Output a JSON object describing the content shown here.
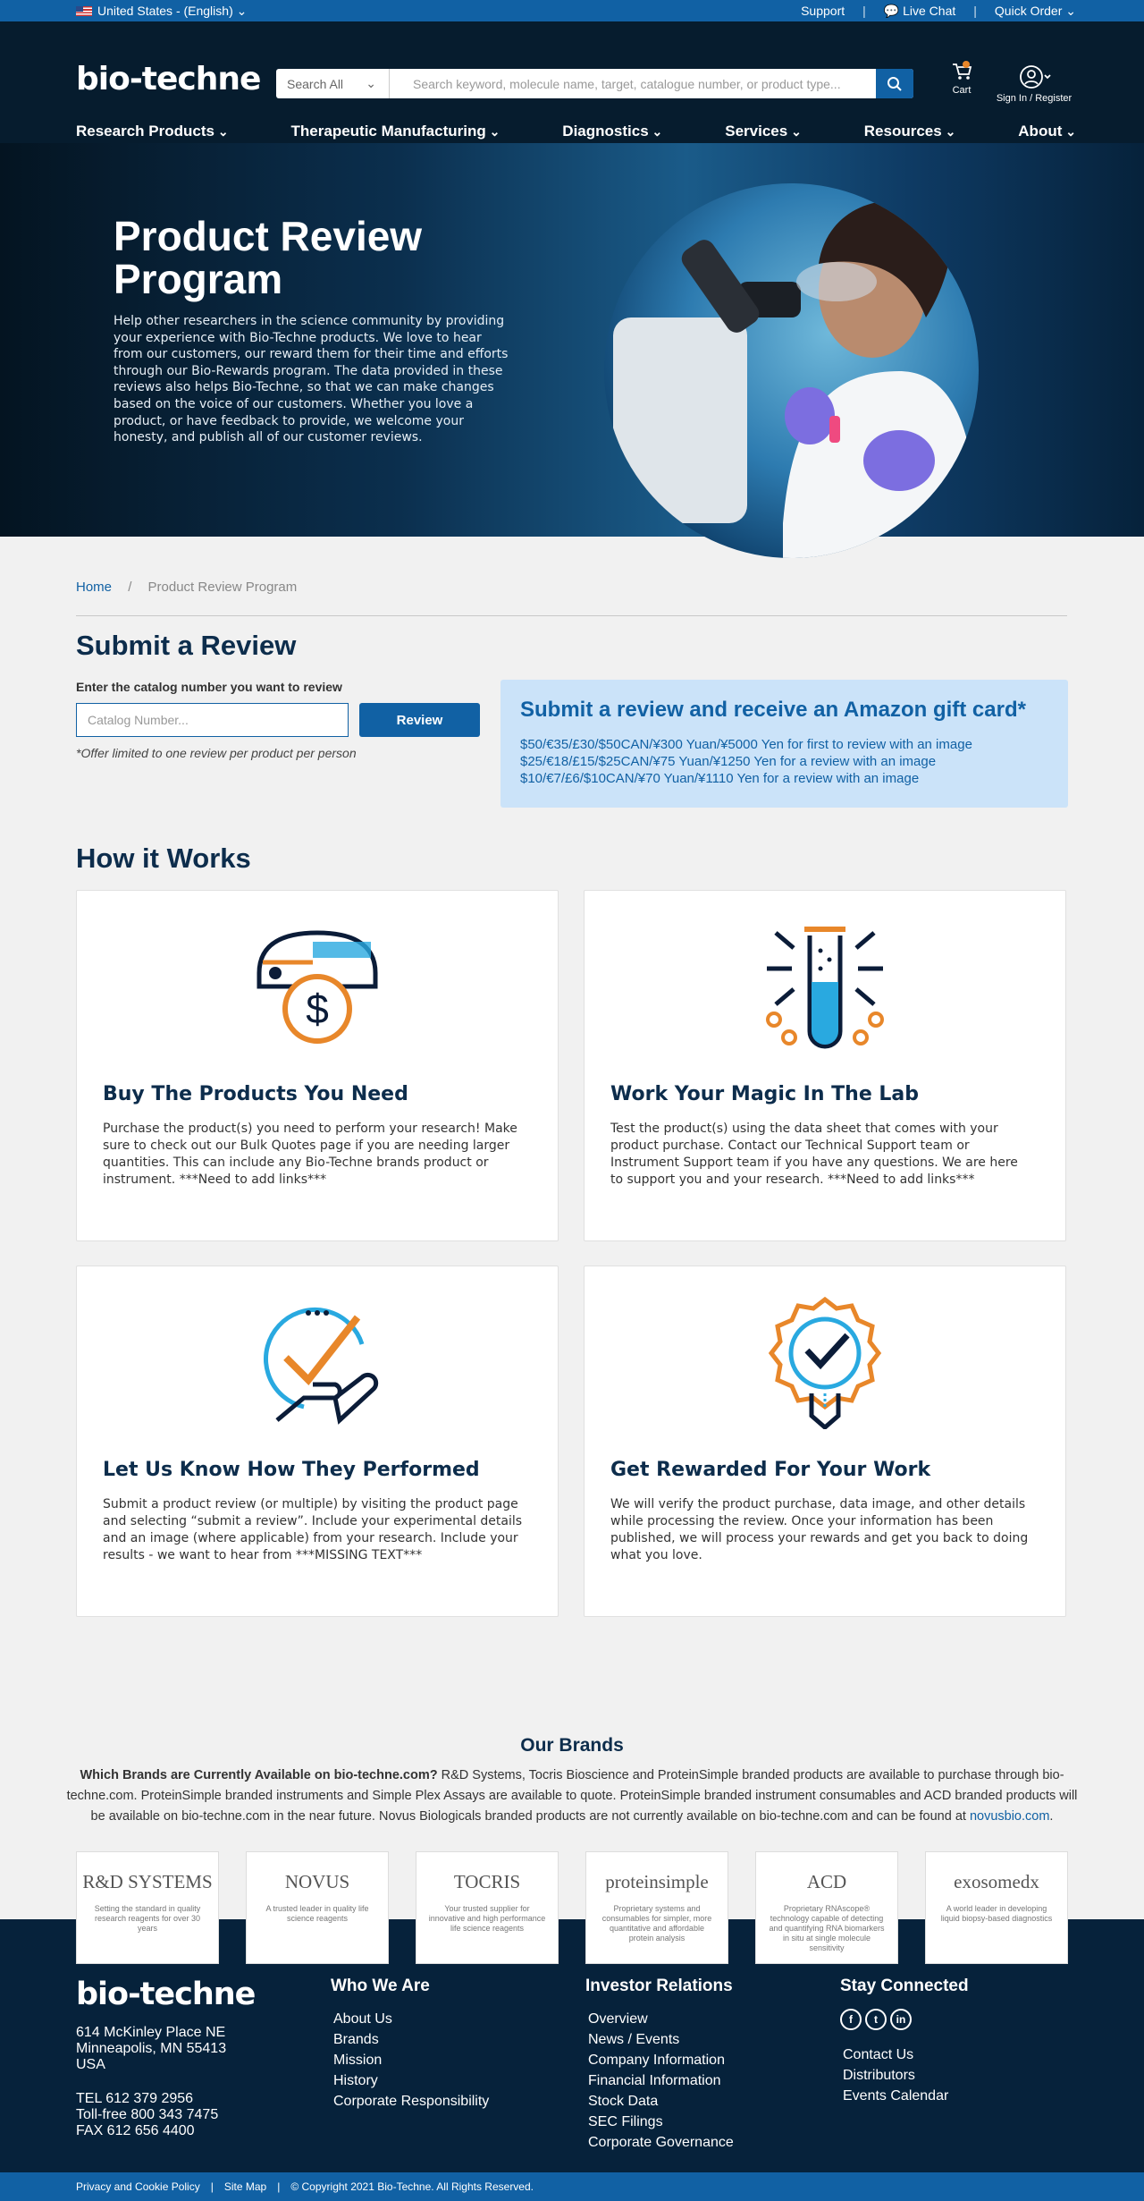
{
  "topbar": {
    "region": "United States - (English)",
    "support": "Support",
    "live_chat": "Live Chat",
    "quick_order": "Quick Order"
  },
  "header": {
    "logo": "bio-techne",
    "search_category": "Search All",
    "search_placeholder": "Search keyword, molecule name, target, catalogue number, or product type...",
    "cart": "Cart",
    "signin": "Sign In / Register",
    "nav": [
      "Research Products",
      "Therapeutic Manufacturing",
      "Diagnostics",
      "Services",
      "Resources",
      "About"
    ]
  },
  "hero": {
    "title": "Product Review Program",
    "text": "Help other researchers in the science community by providing your experience with Bio-Techne products. We love to hear from our customers, our reward them for their time and efforts through our Bio-Rewards program. The data provided in these reviews also helps Bio-Techne, so that we can make changes based on the voice of our customers. Whether you love a product, or have feedback to provide, we welcome your honesty, and publish all of our customer reviews."
  },
  "breadcrumb": {
    "home": "Home",
    "sep": "/",
    "current": "Product Review Program"
  },
  "submit": {
    "title": "Submit a Review",
    "label": "Enter the catalog number you want to review",
    "placeholder": "Catalog Number...",
    "button": "Review",
    "offer": "*Offer limited to one review per product per person"
  },
  "gift": {
    "title": "Submit a review and receive an Amazon gift card*",
    "lines": [
      "$50/€35/£30/$50CAN/¥300 Yuan/¥5000 Yen for first to review with an image",
      "$25/€18/£15/$25CAN/¥75 Yuan/¥1250 Yen for a review with an image",
      "$10/€7/£6/$10CAN/¥70 Yuan/¥1110 Yen for a review with an image"
    ]
  },
  "how": {
    "title": "How it Works",
    "cards": [
      {
        "icon": "dollar-machine-icon",
        "title": "Buy The Products You Need",
        "text": "Purchase the product(s) you need to perform your research! Make sure to check out our Bulk Quotes page if you are needing larger quantities. This can include any Bio-Techne brands product or instrument. ***Need to add links***"
      },
      {
        "icon": "test-tube-icon",
        "title": "Work Your Magic In The Lab",
        "text": "Test the product(s) using the data sheet that comes with your product purchase. Contact our Technical Support team or Instrument Support team if you have any questions. We are here to support you and your research. ***Need to add links***"
      },
      {
        "icon": "check-hand-icon",
        "title": "Let Us Know How They Performed",
        "text": "Submit a product review (or multiple) by visiting the product page and selecting “submit a review”. Include your experimental details and an image (where applicable) from your research. Include your results - we want to hear from ***MISSING TEXT***"
      },
      {
        "icon": "badge-check-icon",
        "title": "Get Rewarded For Your Work",
        "text": "We will verify the product purchase, data image, and other details while processing the review. Once your information has been published, we will process your rewards and get you back to doing what you love."
      }
    ]
  },
  "brands": {
    "title": "Our Brands",
    "lead": "Which Brands are Currently Available on bio-techne.com?",
    "text": " R&D Systems, Tocris Bioscience and ProteinSimple branded products are available to purchase through bio-techne.com. ProteinSimple branded instruments and Simple Plex Assays are available to quote. ProteinSimple branded instrument consumables and ACD branded products will be available on bio-techne.com in the near future. Novus Biologicals branded products are not currently available on bio-techne.com and can be found at ",
    "link": "novusbio.com",
    "end": ".",
    "items": [
      {
        "name": "R&D SYSTEMS",
        "text": "Setting the standard in quality research reagents for over 30 years"
      },
      {
        "name": "NOVUS",
        "text": "A trusted leader in quality life science reagents"
      },
      {
        "name": "TOCRIS",
        "text": "Your trusted supplier for innovative and high performance life science reagents"
      },
      {
        "name": "proteinsimple",
        "text": "Proprietary systems and consumables for simpler, more quantitative and affordable protein analysis"
      },
      {
        "name": "ACD",
        "text": "Proprietary RNAscope® technology capable of detecting and quantifying RNA biomarkers in situ at single molecule sensitivity"
      },
      {
        "name": "exosomedx",
        "text": "A world leader in developing liquid biopsy-based diagnostics"
      }
    ]
  },
  "footer": {
    "logo": "bio-techne",
    "address": [
      "614 McKinley Place NE",
      "Minneapolis, MN 55413",
      "USA"
    ],
    "phones": [
      "TEL 612 379 2956",
      "Toll-free 800 343 7475",
      "FAX 612 656 4400"
    ],
    "who": {
      "title": "Who We Are",
      "links": [
        "About Us",
        "Brands",
        "Mission",
        "History",
        "Corporate Responsibility"
      ]
    },
    "investor": {
      "title": "Investor Relations",
      "links": [
        "Overview",
        "News / Events",
        "Company Information",
        "Financial Information",
        "Stock Data",
        "SEC Filings",
        "Corporate Governance"
      ]
    },
    "connected": {
      "title": "Stay Connected",
      "links": [
        "Contact Us",
        "Distributors",
        "Events Calendar"
      ]
    },
    "bottom": [
      "Privacy and Cookie Policy",
      "Site Map",
      "© Copyright 2021 Bio-Techne. All Rights Reserved."
    ]
  },
  "colors": {
    "brand_blue": "#1161a4",
    "navy": "#061c2e",
    "orange": "#e8872a",
    "cyan": "#29a9e0"
  }
}
